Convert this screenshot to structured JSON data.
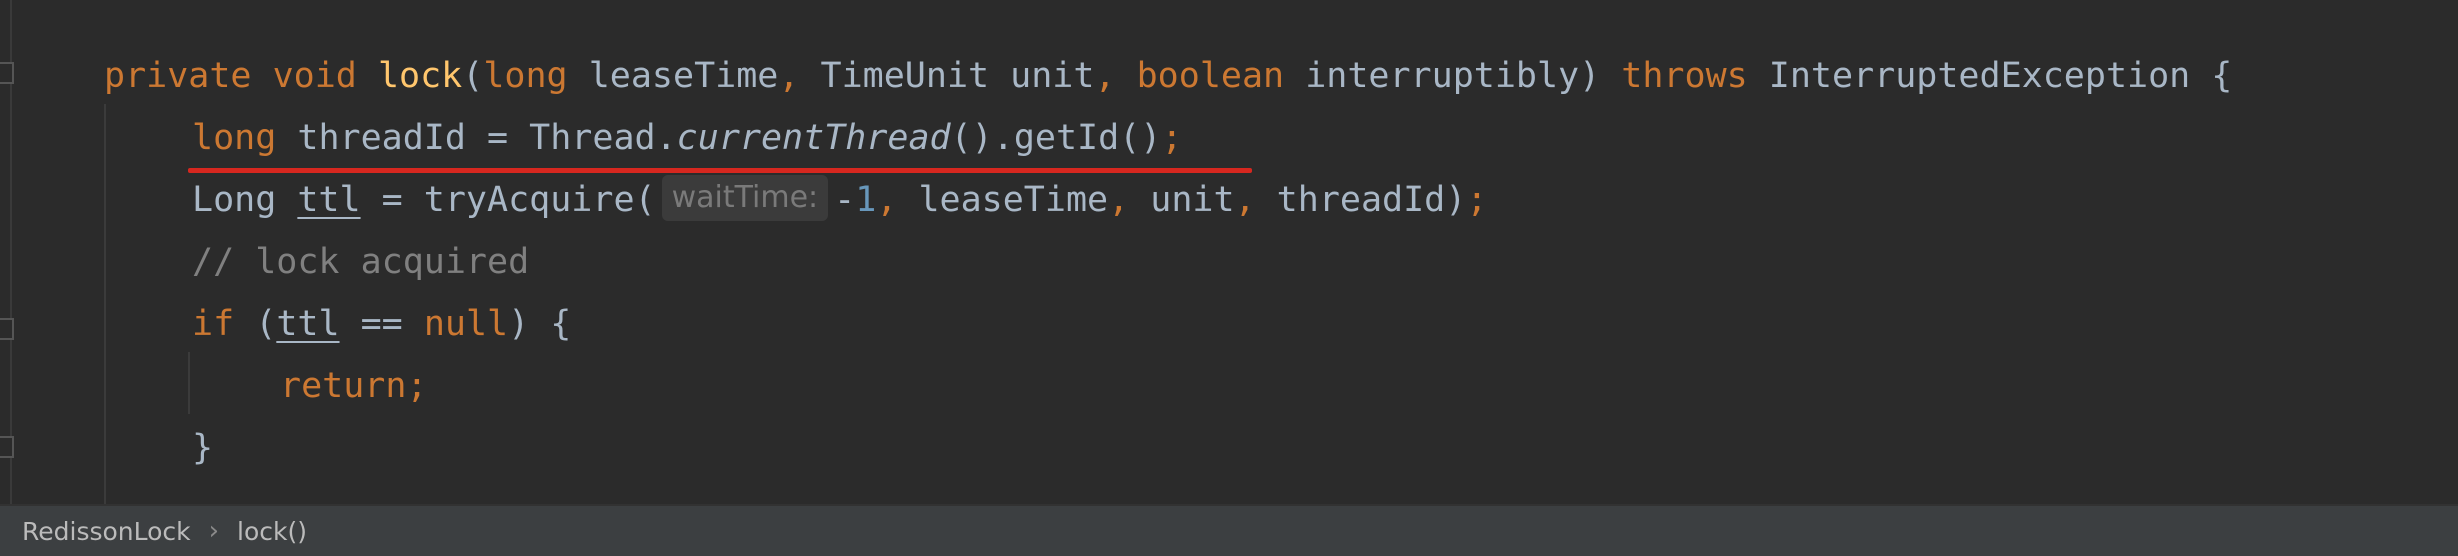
{
  "code": {
    "lines": [
      {
        "tokens": [
          {
            "t": "private",
            "c": "kw"
          },
          {
            "t": " ",
            "c": "pl"
          },
          {
            "t": "void",
            "c": "kw"
          },
          {
            "t": " ",
            "c": "pl"
          },
          {
            "t": "lock",
            "c": "fn"
          },
          {
            "t": "(",
            "c": "pl"
          },
          {
            "t": "long",
            "c": "kw"
          },
          {
            "t": " leaseTime",
            "c": "pl"
          },
          {
            "t": ",",
            "c": "kw"
          },
          {
            "t": " TimeUnit unit",
            "c": "pl"
          },
          {
            "t": ",",
            "c": "kw"
          },
          {
            "t": " ",
            "c": "pl"
          },
          {
            "t": "boolean",
            "c": "kw"
          },
          {
            "t": " interruptibly) ",
            "c": "pl"
          },
          {
            "t": "throws",
            "c": "kw"
          },
          {
            "t": " InterruptedException {",
            "c": "pl"
          }
        ]
      },
      {
        "tokens": [
          {
            "t": "long",
            "c": "kw"
          },
          {
            "t": " threadId = Thread.",
            "c": "pl"
          },
          {
            "t": "currentThread",
            "c": "pl it"
          },
          {
            "t": "().getId()",
            "c": "pl"
          },
          {
            "t": ";",
            "c": "kw"
          }
        ]
      },
      {
        "tokens": [
          {
            "t": "Long ",
            "c": "pl"
          },
          {
            "t": "ttl",
            "c": "pl ul"
          },
          {
            "t": " = tryAcquire(",
            "c": "pl"
          },
          {
            "t": "waitTime:",
            "c": "hint"
          },
          {
            "t": "-",
            "c": "pl"
          },
          {
            "t": "1",
            "c": "num"
          },
          {
            "t": ",",
            "c": "kw"
          },
          {
            "t": " leaseTime",
            "c": "pl"
          },
          {
            "t": ",",
            "c": "kw"
          },
          {
            "t": " unit",
            "c": "pl"
          },
          {
            "t": ",",
            "c": "kw"
          },
          {
            "t": " threadId)",
            "c": "pl"
          },
          {
            "t": ";",
            "c": "kw"
          }
        ]
      },
      {
        "tokens": [
          {
            "t": "// lock acquired",
            "c": "cm"
          }
        ]
      },
      {
        "tokens": [
          {
            "t": "if",
            "c": "kw"
          },
          {
            "t": " (",
            "c": "pl"
          },
          {
            "t": "ttl",
            "c": "pl ul"
          },
          {
            "t": " == ",
            "c": "pl"
          },
          {
            "t": "null",
            "c": "kw"
          },
          {
            "t": ") {",
            "c": "pl"
          }
        ]
      },
      {
        "tokens": [
          {
            "t": "return;",
            "c": "kw"
          }
        ]
      },
      {
        "tokens": [
          {
            "t": "}",
            "c": "pl"
          }
        ]
      }
    ]
  },
  "breadcrumb": {
    "items": [
      "RedissonLock",
      "lock()"
    ],
    "separator": "›"
  }
}
